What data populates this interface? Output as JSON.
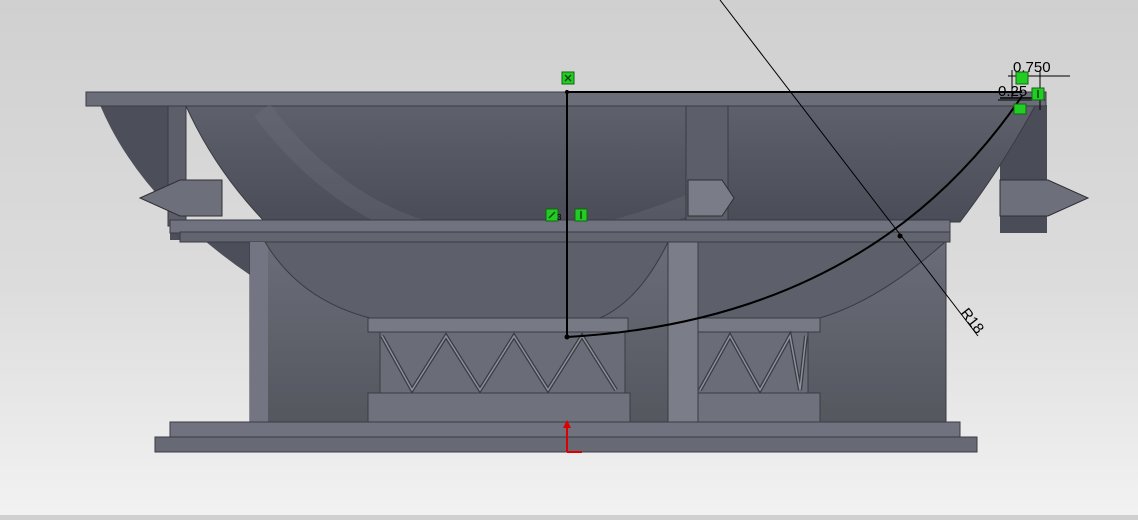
{
  "viewport": {
    "background_top": "#d0d0d0",
    "background_bottom": "#f2f2f2"
  },
  "part": {
    "body_color": "#5a5c68",
    "shadow_color": "#40414a",
    "highlight_color": "#8a8c98"
  },
  "sketch": {
    "line_color": "#000000",
    "relation_color": "#22cc22",
    "origin_color": "#dd0000"
  },
  "dimensions": {
    "top_width": "0.750",
    "small_offset": "0.25",
    "radius": "R18"
  },
  "icons": {
    "relation_fix": "fix-relation-icon",
    "relation_vertical": "vertical-relation-icon",
    "relation_coincident": "coincident-relation-icon",
    "origin": "origin-icon"
  }
}
